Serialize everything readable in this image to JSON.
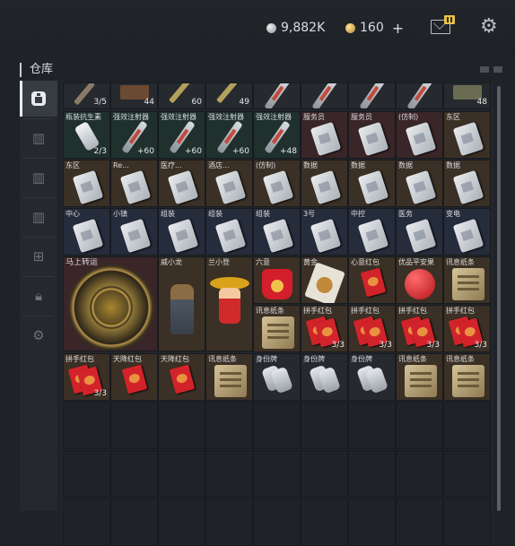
{
  "header": {
    "silver_amount": "9,882K",
    "gold_amount": "160",
    "gold_plus": "+",
    "icons": [
      "silver-coin-icon",
      "gold-coin-icon",
      "mail-icon",
      "settings-gear-icon"
    ]
  },
  "section": {
    "title": "仓库"
  },
  "sidebar": {
    "items": [
      {
        "icon": "home-storage-icon",
        "active": true
      },
      {
        "icon": "storage-tab-3-icon",
        "active": false
      },
      {
        "icon": "storage-tab-2-icon",
        "active": false
      },
      {
        "icon": "storage-tab-4-icon",
        "active": false
      },
      {
        "icon": "storage-tab-add-icon",
        "active": false
      },
      {
        "icon": "lock-icon",
        "active": false
      },
      {
        "icon": "settings-gear-icon",
        "active": false
      }
    ]
  },
  "items": {
    "r0": [
      "3/5",
      "44",
      "60",
      "49",
      "",
      "",
      "",
      "",
      "48"
    ],
    "c_bottle": {
      "name": "瓶装抗生素",
      "count": "2/3"
    },
    "c_inj1": {
      "name": "强效注射器",
      "count": "+60"
    },
    "c_inj2": {
      "name": "强效注射器",
      "count": "+60"
    },
    "c_inj3": {
      "name": "强效注射器",
      "count": "+60"
    },
    "c_inj4": {
      "name": "强效注射器",
      "count": "+48"
    },
    "c_fw1": {
      "name": "服务员"
    },
    "c_fw2": {
      "name": "服务员"
    },
    "c_fz": {
      "name": "(仿制)"
    },
    "c_dq": {
      "name": "东区"
    },
    "c_dq2": {
      "name": "东区"
    },
    "c_re": {
      "name": "Re..."
    },
    "c_yl": {
      "name": "医疗..."
    },
    "c_jd": {
      "name": "酒店..."
    },
    "c_fz2": {
      "name": "(仿制)"
    },
    "c_sj1": {
      "name": "数据"
    },
    "c_sj2": {
      "name": "数据"
    },
    "c_sj3": {
      "name": "数据"
    },
    "c_sj4": {
      "name": "数据"
    },
    "c_zx": {
      "name": "中心"
    },
    "c_xz": {
      "name": "小镇"
    },
    "c_zj1": {
      "name": "组装"
    },
    "c_zj2": {
      "name": "组装"
    },
    "c_zj3": {
      "name": "组装"
    },
    "c_3h": {
      "name": "3号"
    },
    "c_zk": {
      "name": "中控"
    },
    "c_yw": {
      "name": "医务"
    },
    "c_bd": {
      "name": "变电"
    },
    "c_msly": {
      "name": "马上转运"
    },
    "c_wxl": {
      "name": "威小龙"
    },
    "c_lxd": {
      "name": "兰小登"
    },
    "c_lx": {
      "name": "六意"
    },
    "c_hj": {
      "name": "黄金"
    },
    "c_xyhb": {
      "name": "心意红包"
    },
    "c_ypgz": {
      "name": "优品平安果"
    },
    "c_xxjc1": {
      "name": "讯息纸条"
    },
    "c_xxjc2": {
      "name": "讯息纸条"
    },
    "c_psb1": {
      "name": "拼手红包",
      "count": "3/3"
    },
    "c_psb2": {
      "name": "拼手红包",
      "count": "3/3"
    },
    "c_psb3": {
      "name": "拼手红包",
      "count": "3/3"
    },
    "c_psb4": {
      "name": "拼手红包",
      "count": "3/3"
    },
    "c_pswb": {
      "name": "拼手红包",
      "count": "3/3"
    },
    "c_tjhb1": {
      "name": "天降红包"
    },
    "c_tjhb2": {
      "name": "天降红包"
    },
    "c_xxjc3": {
      "name": "讯息纸条"
    },
    "c_sfp1": {
      "name": "身份牌"
    },
    "c_sfp2": {
      "name": "身份牌"
    },
    "c_sfp3": {
      "name": "身份牌"
    },
    "c_xxjc4": {
      "name": "讯息纸条"
    },
    "c_xxjc5": {
      "name": "讯息纸条"
    }
  }
}
